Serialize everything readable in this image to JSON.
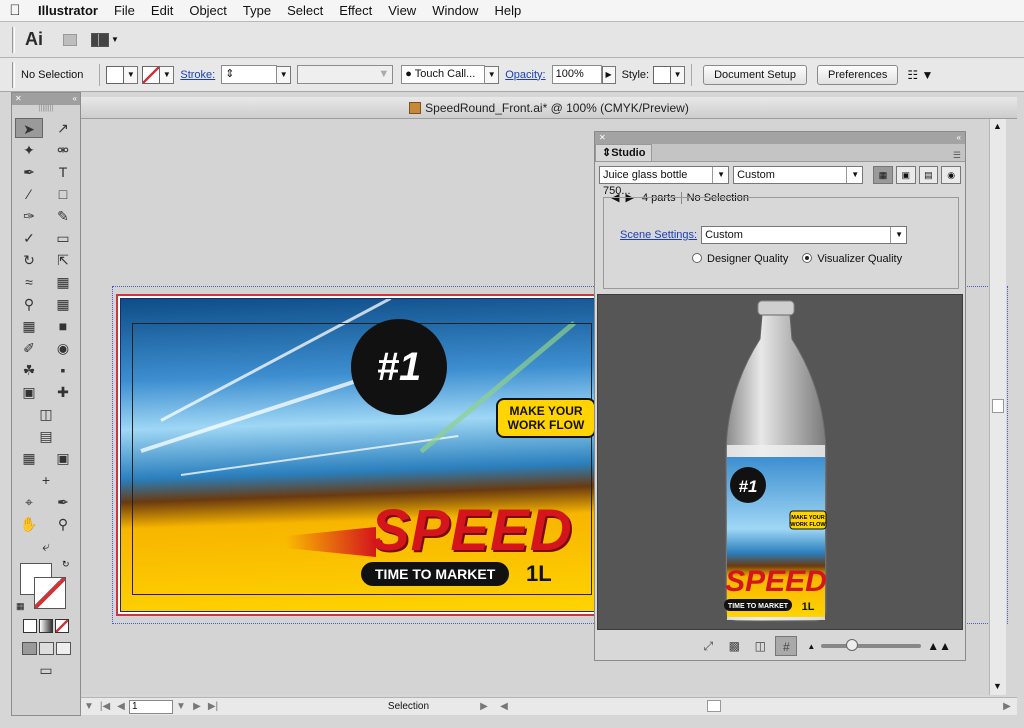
{
  "menubar": {
    "apple_icon": "apple-icon",
    "app_name": "Illustrator",
    "items": [
      "File",
      "Edit",
      "Object",
      "Type",
      "Select",
      "Effect",
      "View",
      "Window",
      "Help"
    ]
  },
  "appbar": {
    "logo": "Ai"
  },
  "controlbar": {
    "selection": "No Selection",
    "stroke_label": "Stroke:",
    "brush": "Touch Call...",
    "opacity_label": "Opacity:",
    "opacity_value": "100%",
    "style_label": "Style:",
    "document_setup": "Document Setup",
    "preferences": "Preferences"
  },
  "document": {
    "title": "SpeedRound_Front.ai* @ 100% (CMYK/Preview)",
    "page_number": "1",
    "status": "Selection"
  },
  "artwork": {
    "badge": "#1",
    "tagline_line1": "MAKE YOUR",
    "tagline_line2": "WORK FLOW",
    "headline": "SPEED",
    "subline": "TIME TO MARKET",
    "volume": "1L"
  },
  "studio": {
    "tab": "Studio",
    "model_select": "Juice glass bottle 750...",
    "preset_select": "Custom",
    "parts_label": "4 parts",
    "parts_selection": "No Selection",
    "scene_settings_label": "Scene Settings:",
    "scene_settings_value": "Custom",
    "quality_options": [
      {
        "label": "Designer Quality",
        "selected": false
      },
      {
        "label": "Visualizer Quality",
        "selected": true
      }
    ]
  },
  "colors": {
    "accent_link": "#1a3fb8",
    "artboard_border": "#d0343a",
    "speed_red": "#d4151c",
    "label_yellow": "#ffd400"
  }
}
